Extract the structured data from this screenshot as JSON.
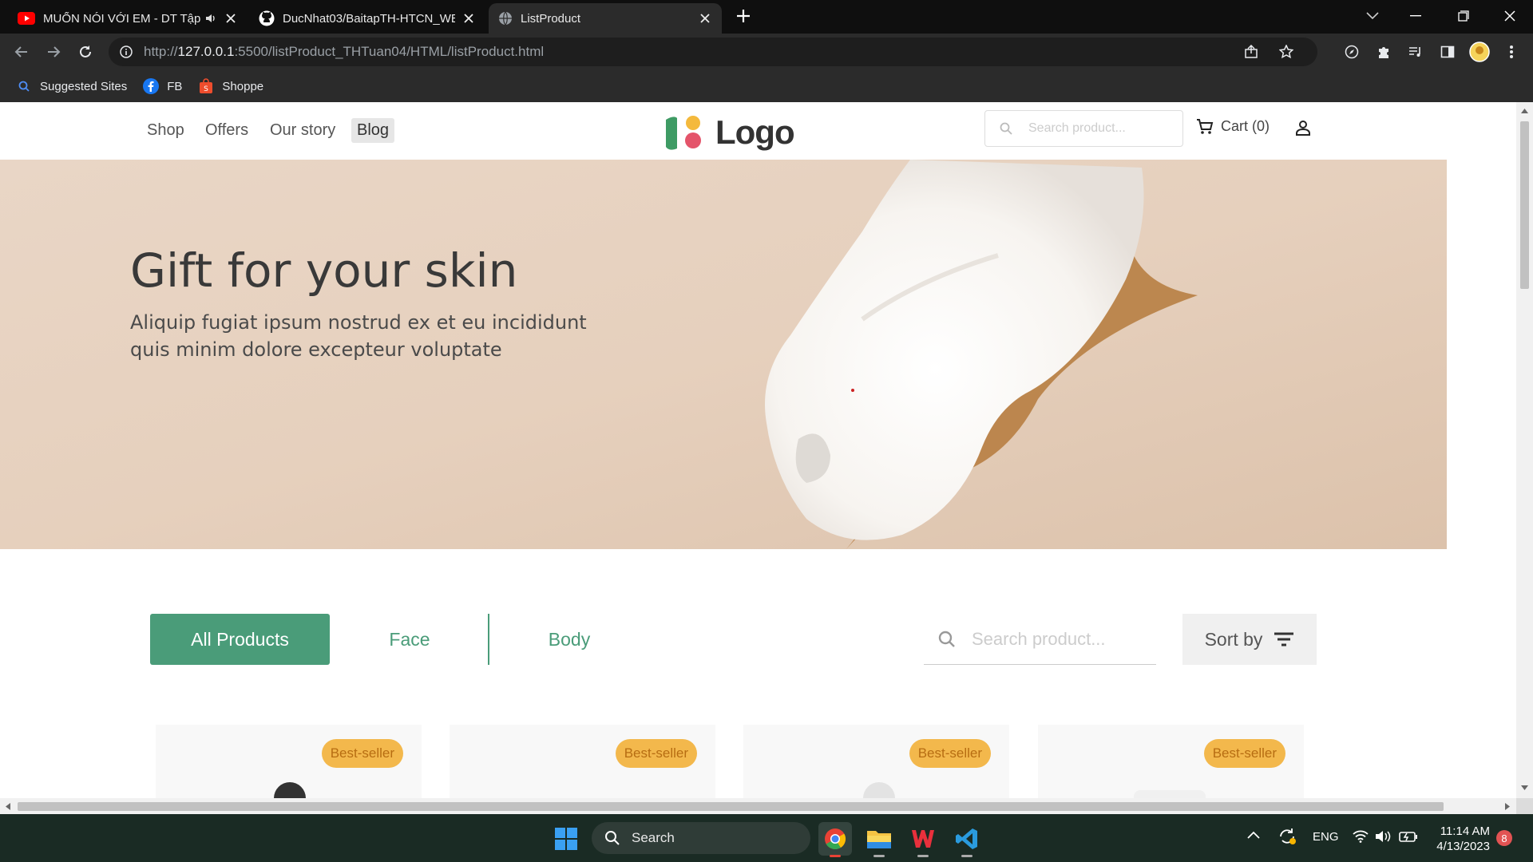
{
  "browser": {
    "tabs": [
      {
        "title": "MUỐN NÓI VỚI EM - DT Tập",
        "icon": "youtube-icon",
        "audio": true
      },
      {
        "title": "DucNhat03/BaitapTH-HTCN_WEB",
        "icon": "github-icon"
      },
      {
        "title": "ListProduct",
        "icon": "globe-icon",
        "active": true
      }
    ],
    "url_prefix": "http://",
    "url_host": "127.0.0.1",
    "url_rest": ":5500/listProduct_THTuan04/HTML/listProduct.html",
    "bookmarks": [
      {
        "label": "Suggested Sites",
        "icon": "search-icon"
      },
      {
        "label": "FB",
        "icon": "facebook-icon"
      },
      {
        "label": "Shoppe",
        "icon": "shopee-icon"
      }
    ]
  },
  "site": {
    "nav": [
      "Shop",
      "Offers",
      "Our story",
      "Blog"
    ],
    "logo_text": "Logo",
    "search_placeholder": "Search product...",
    "cart_label": "Cart (0)",
    "hero": {
      "title": "Gift for your skin",
      "subtitle": "Aliquip fugiat ipsum nostrud ex et eu incididunt quis minim dolore excepteur voluptate"
    },
    "filters": {
      "all": "All Products",
      "face": "Face",
      "body": "Body",
      "search_placeholder": "Search product...",
      "sort_label": "Sort by"
    },
    "products": [
      {
        "badge": "Best-seller"
      },
      {
        "badge": "Best-seller"
      },
      {
        "badge": "Best-seller"
      },
      {
        "badge": "Best-seller"
      }
    ]
  },
  "taskbar": {
    "search_label": "Search",
    "lang": "ENG",
    "time": "11:14 AM",
    "date": "4/13/2023",
    "notifications": "8"
  },
  "colors": {
    "accent": "#4a9c79",
    "badge": "#f3b84c",
    "hero_bg": "#e7d3c2"
  }
}
